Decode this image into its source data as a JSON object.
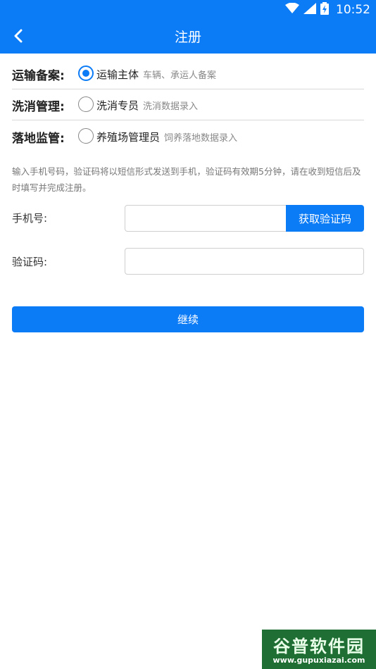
{
  "status_bar": {
    "time": "10:52",
    "icons": [
      "wifi-icon",
      "signal-icon",
      "battery-icon"
    ]
  },
  "app_bar": {
    "title": "注册",
    "back_icon": "back-arrow-icon"
  },
  "roles": [
    {
      "label": "运输备案:",
      "name": "运输主体",
      "desc": "车辆、承运人备案",
      "checked": true
    },
    {
      "label": "洗消管理:",
      "name": "洗消专员",
      "desc": "洗消数据录入",
      "checked": false
    },
    {
      "label": "落地监管:",
      "name": "养殖场管理员",
      "desc": "饲养落地数据录入",
      "checked": false
    }
  ],
  "hint": "输入手机号码，验证码将以短信形式发送到手机，验证码有效期5分钟，请在收到短信后及时填写并完成注册。",
  "form": {
    "phone_label": "手机号:",
    "phone_value": "",
    "get_code_label": "获取验证码",
    "code_label": "验证码:",
    "code_value": ""
  },
  "continue_label": "继续",
  "watermark": {
    "title": "谷普软件园",
    "url": "www.gupuxiazai.com"
  },
  "colors": {
    "primary": "#0b7bf6",
    "separator": "#d9d9d9",
    "watermark_bg": "#1f6e33"
  }
}
